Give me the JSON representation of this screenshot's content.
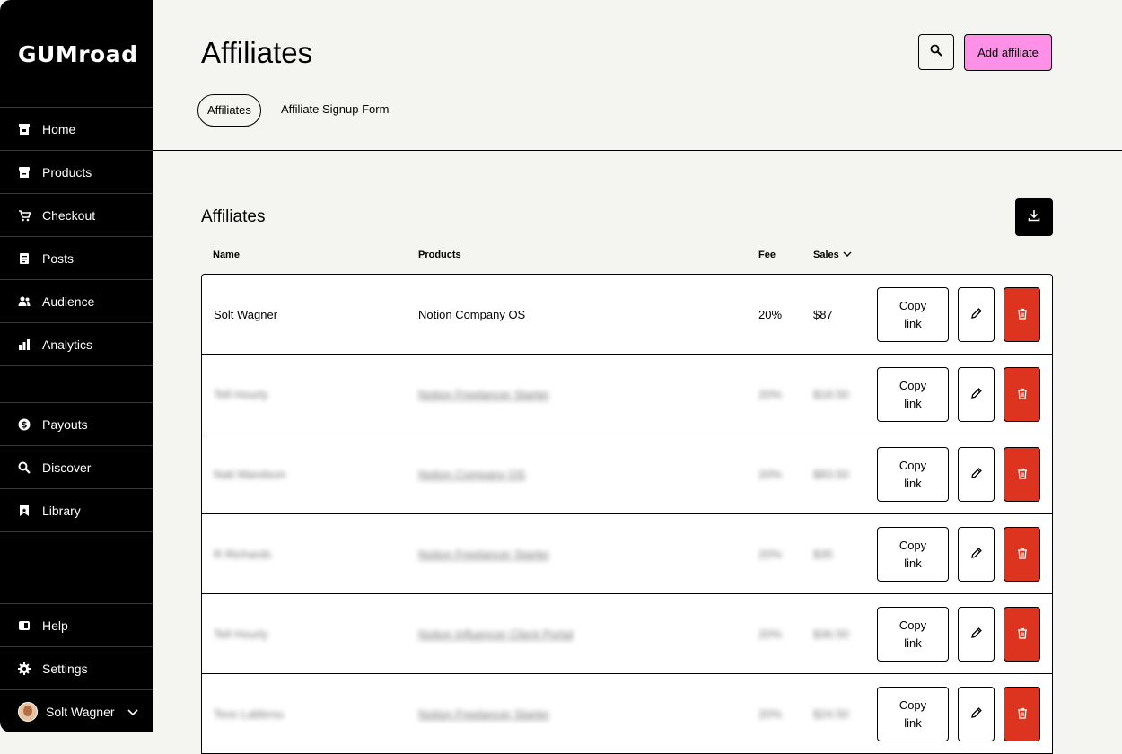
{
  "brand": "GUMroad",
  "sidebar": {
    "top_items": [
      {
        "label": "Home",
        "icon": "store-icon"
      },
      {
        "label": "Products",
        "icon": "archive-icon"
      },
      {
        "label": "Checkout",
        "icon": "cart-icon"
      },
      {
        "label": "Posts",
        "icon": "document-icon"
      },
      {
        "label": "Audience",
        "icon": "people-icon"
      },
      {
        "label": "Analytics",
        "icon": "bar-chart-icon"
      }
    ],
    "mid_items": [
      {
        "label": "Payouts",
        "icon": "dollar-icon"
      },
      {
        "label": "Discover",
        "icon": "search-icon"
      },
      {
        "label": "Library",
        "icon": "bookmark-icon"
      }
    ],
    "bottom_items": [
      {
        "label": "Help",
        "icon": "book-icon"
      },
      {
        "label": "Settings",
        "icon": "gear-icon"
      }
    ],
    "user": {
      "name": "Solt Wagner"
    }
  },
  "header": {
    "title": "Affiliates",
    "tabs": [
      {
        "label": "Affiliates",
        "active": true
      },
      {
        "label": "Affiliate Signup Form",
        "active": false
      }
    ],
    "add_label": "Add affiliate"
  },
  "section": {
    "title": "Affiliates"
  },
  "table": {
    "columns": {
      "name": "Name",
      "products": "Products",
      "fee": "Fee",
      "sales": "Sales"
    },
    "copy_label": [
      "Copy",
      "link"
    ],
    "rows": [
      {
        "name": "Solt Wagner",
        "product": "Notion Company OS",
        "fee": "20%",
        "sales": "$87",
        "blurred": false
      },
      {
        "name": "Tell Hourly",
        "product": "Notion Freelancer Starter",
        "fee": "20%",
        "sales": "$18.50",
        "blurred": true
      },
      {
        "name": "Nati Mandson",
        "product": "Notion Company OS",
        "fee": "20%",
        "sales": "$83.50",
        "blurred": true
      },
      {
        "name": "R Richards",
        "product": "Notion Freelancer Starter",
        "fee": "20%",
        "sales": "$35",
        "blurred": true
      },
      {
        "name": "Tell Hourly",
        "product": "Notion Influencer Client Portal",
        "fee": "20%",
        "sales": "$36.50",
        "blurred": true
      },
      {
        "name": "Tess Labbrou",
        "product": "Notion Freelancer Starter",
        "fee": "20%",
        "sales": "$24.50",
        "blurred": true
      }
    ]
  },
  "colors": {
    "accent": "#ff90e8",
    "danger": "#dc341e",
    "sidebar": "#000000",
    "background": "#f4f4f0"
  }
}
